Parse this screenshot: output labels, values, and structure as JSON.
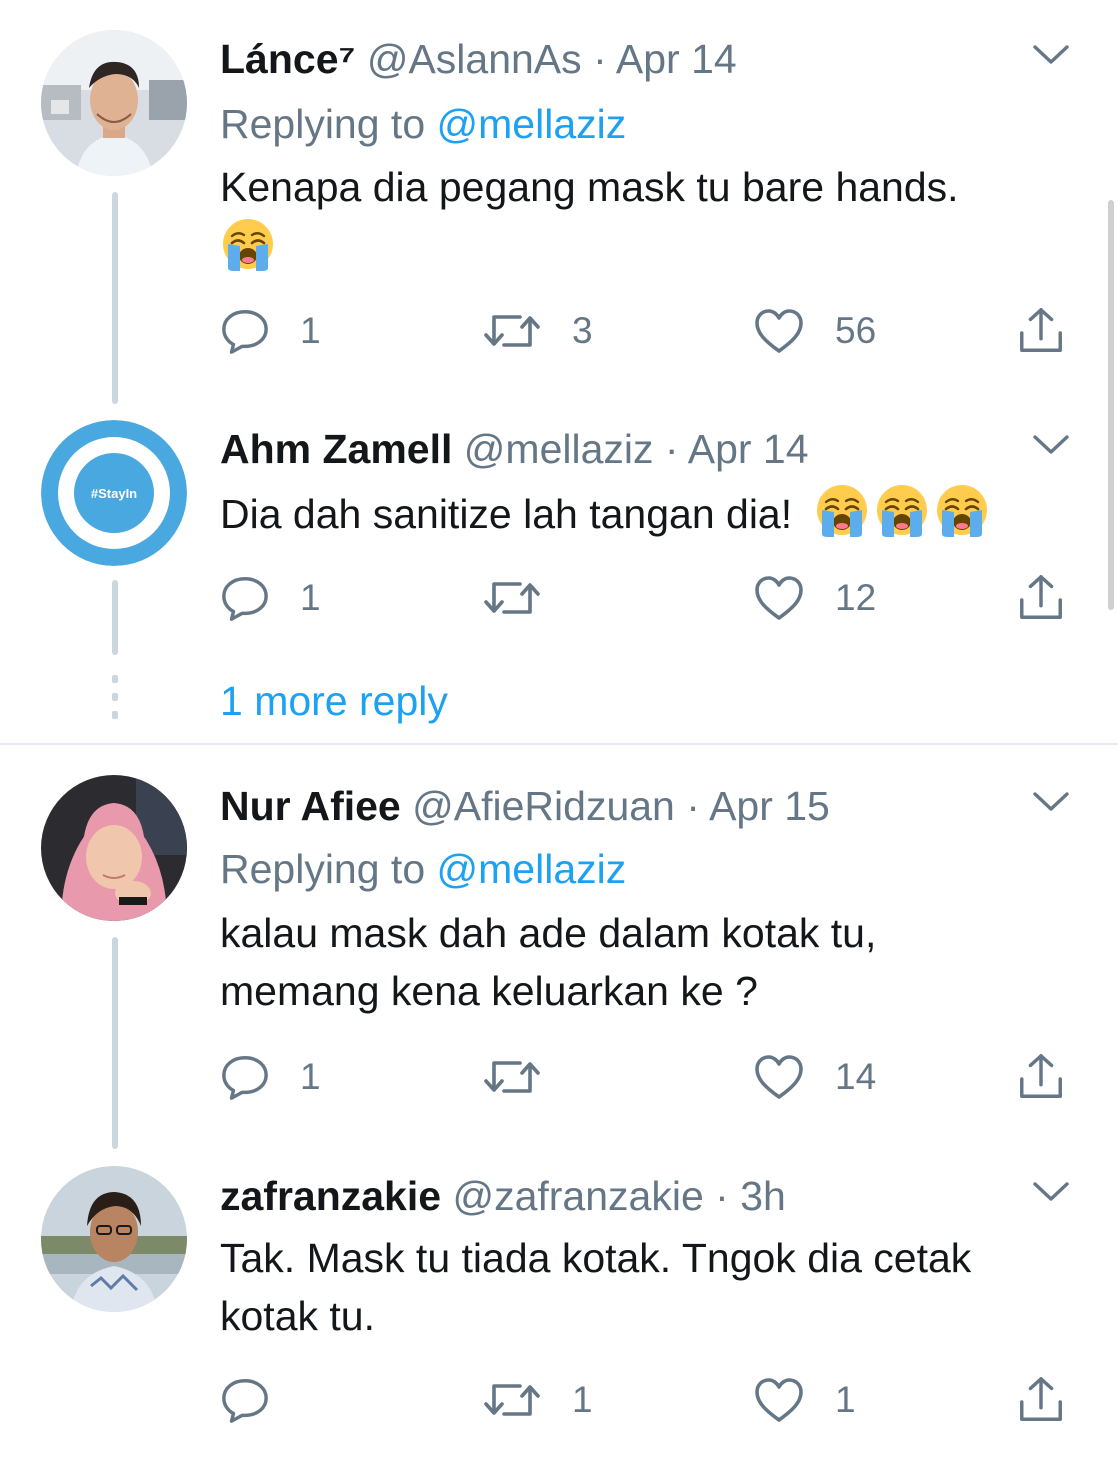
{
  "tweets": [
    {
      "name": "Lánce⁷",
      "handle": "@AslannAs",
      "separator": "·",
      "date": "Apr 14",
      "replying_prefix": "Replying to",
      "replying_to": "@mellaziz",
      "text": "Kenapa dia pegang mask tu bare hands.",
      "emoji": "loudly-crying-face",
      "replies": "1",
      "retweets": "3",
      "likes": "56"
    },
    {
      "name": "Ahm Zamell",
      "handle": "@mellaziz",
      "separator": "·",
      "date": "Apr 14",
      "text": "Dia dah sanitize lah tangan dia!",
      "emoji": "loudly-crying-face",
      "emoji_count": 3,
      "avatar_text": "#StayIn",
      "replies": "1",
      "retweets": "",
      "likes": "12"
    },
    {
      "name": "Nur Afiee",
      "handle": "@AfieRidzuan",
      "separator": "·",
      "date": "Apr 15",
      "replying_prefix": "Replying to",
      "replying_to": "@mellaziz",
      "text_line1": "kalau mask dah ade dalam kotak tu,",
      "text_line2": "memang kena keluarkan ke ?",
      "replies": "1",
      "retweets": "",
      "likes": "14"
    },
    {
      "name": "zafranzakie",
      "handle": "@zafranzakie",
      "separator": "·",
      "date": "3h",
      "text_line1": "Tak. Mask tu tiada kotak. Tngok dia cetak",
      "text_line2": "kotak tu.",
      "replies": "",
      "retweets": "1",
      "likes": "1"
    }
  ],
  "more_reply": "1 more reply",
  "colors": {
    "link": "#1da1f2",
    "secondary_text": "#657786",
    "primary_text": "#14171a",
    "thread_line": "#ccd6dd",
    "stayin_ring": "#4aa8e0"
  },
  "icons": [
    "reply-icon",
    "retweet-icon",
    "like-icon",
    "share-icon",
    "caret-down-icon"
  ]
}
